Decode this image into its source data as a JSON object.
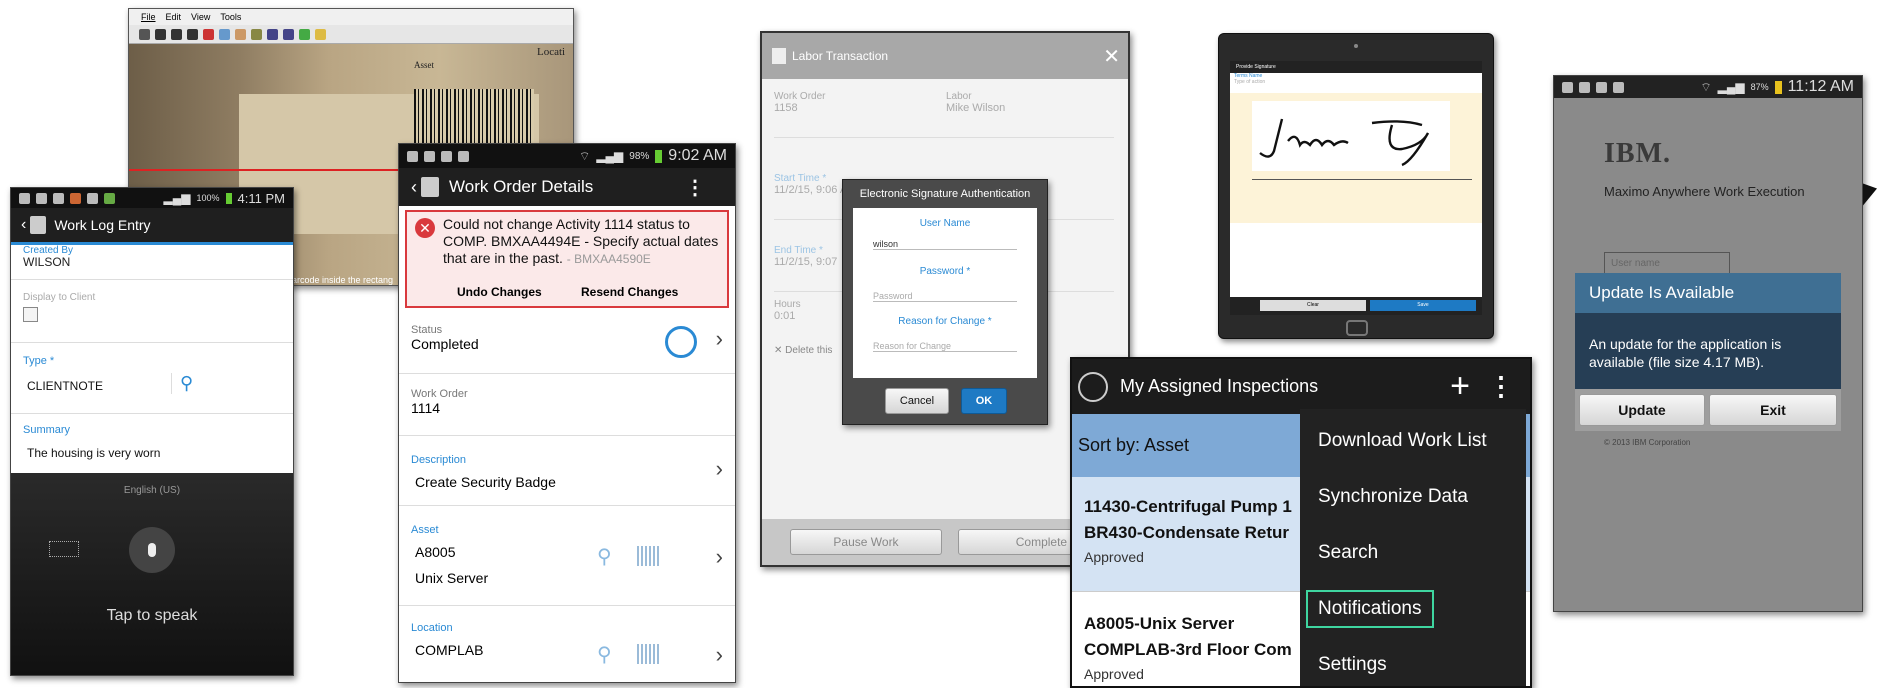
{
  "scanner": {
    "menu": [
      "File",
      "Edit",
      "View",
      "Tools"
    ],
    "hint": "arcode inside the rectang",
    "labels": [
      "Asset",
      "Locati"
    ]
  },
  "worklog": {
    "status_time": "4:11 PM",
    "battery": "100%",
    "title": "Work Log Entry",
    "created_by_label": "Created By",
    "created_by": "WILSON",
    "display_client_label": "Display to Client",
    "type_label": "Type *",
    "type_value": "CLIENTNOTE",
    "summary_label": "Summary",
    "summary_value": "The housing is very worn",
    "language": "English (US)",
    "tap_to_speak": "Tap to speak"
  },
  "workorder": {
    "status_time": "9:02 AM",
    "battery": "98%",
    "title": "Work Order Details",
    "error_text": "Could not change Activity 1114 status to COMP. BMXAA4494E - Specify actual dates that are in the past.",
    "error_code": "- BMXAA4590E",
    "undo": "Undo Changes",
    "resend": "Resend Changes",
    "status_label": "Status",
    "status_value": "Completed",
    "wo_label": "Work Order",
    "wo_value": "1114",
    "desc_label": "Description",
    "desc_value": "Create Security Badge",
    "asset_label": "Asset",
    "asset_value": "A8005",
    "asset_desc": "Unix Server",
    "location_label": "Location",
    "location_value": "COMPLAB"
  },
  "labor": {
    "title": "Labor Transaction",
    "wo_label": "Work Order",
    "wo_value": "1158",
    "labor_label": "Labor",
    "labor_value": "Mike Wilson",
    "start_label": "Start Time *",
    "start_value": "11/2/15, 9:06 AM",
    "end_label": "End Time *",
    "end_value": "11/2/15, 9:07",
    "hours_label": "Hours",
    "hours_value": "0:01",
    "delete": "Delete this",
    "pause": "Pause Work",
    "complete": "Complete Wor",
    "dialog": {
      "title": "Electronic Signature Authentication",
      "user_label": "User Name",
      "user_value": "wilson",
      "password_label": "Password *",
      "password_placeholder": "Password",
      "reason_label": "Reason for Change *",
      "reason_placeholder": "Reason for Change",
      "cancel": "Cancel",
      "ok": "OK"
    }
  },
  "signature": {
    "title": "Provide Signature",
    "subtitle": "Terms Name",
    "subtitle2": "Type of action",
    "clear": "Clear",
    "save": "Save"
  },
  "inspections": {
    "title": "My Assigned Inspections",
    "sort": "Sort by: Asset",
    "items": [
      {
        "line1": "11430-Centrifugal Pump 1",
        "line2": "BR430-Condensate Retur",
        "status": "Approved"
      },
      {
        "line1": "A8005-Unix Server",
        "line2": "COMPLAB-3rd Floor Com",
        "status": "Approved"
      }
    ],
    "menu": [
      "Download Work List",
      "Synchronize Data",
      "Search",
      "Notifications",
      "Settings"
    ]
  },
  "update": {
    "status_time": "11:12 AM",
    "battery": "87%",
    "logo": "IBM.",
    "app_name": "Maximo Anywhere Work Execution",
    "user_placeholder": "User name",
    "dialog_title": "Update Is Available",
    "dialog_text": "An update for the application is available (file size 4.17 MB).",
    "update_btn": "Update",
    "exit_btn": "Exit",
    "copyright": "© 2013 IBM Corporation"
  },
  "colors": {
    "accent_blue": "#2a8ad4",
    "error_red": "#d9393d",
    "dark_bar": "#1c1c1c",
    "sort_bar": "#7ea9d6",
    "update_title": "#3f6f93",
    "update_body": "#263e55"
  }
}
